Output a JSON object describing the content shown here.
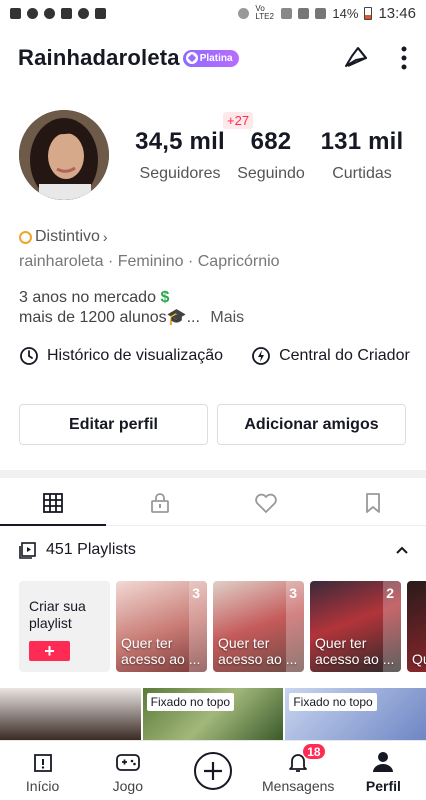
{
  "status_bar": {
    "battery": "14%",
    "time": "13:46",
    "network": "Vo LTE2"
  },
  "header": {
    "username": "Rainhadaroleta",
    "badge": "Platina"
  },
  "stats": {
    "followers": {
      "value": "34,5 mil",
      "label": "Seguidores"
    },
    "following": {
      "value": "682",
      "label": "Seguindo",
      "delta": "+27"
    },
    "likes": {
      "value": "131 mil",
      "label": "Curtidas"
    }
  },
  "profile": {
    "distintivo": "Distintivo",
    "meta": "rainharoleta · Feminino · Capricórnio",
    "bio_line1": "3 anos no mercado",
    "bio_line1_emoji": "$",
    "bio_line2": "mais de 1200 alunos🎓...",
    "bio_more": "Mais"
  },
  "shortcuts": [
    {
      "label": "Histórico de visualização",
      "icon": "clock-icon"
    },
    {
      "label": "Central do Criador",
      "icon": "lightning-icon"
    }
  ],
  "buttons": {
    "edit": "Editar perfil",
    "add_friends": "Adicionar amigos"
  },
  "tabs": [
    "videos-grid-icon",
    "lock-icon",
    "heart-icon",
    "bookmark-icon"
  ],
  "playlists": {
    "header": "451 Playlists",
    "create_label": "Criar sua playlist",
    "create_button": "+",
    "items": [
      {
        "count": "3",
        "title": "Quer ter acesso ao ..."
      },
      {
        "count": "3",
        "title": "Quer ter acesso ao ..."
      },
      {
        "count": "2",
        "title": "Quer ter acesso ao ..."
      },
      {
        "count": "",
        "title": "Qu"
      }
    ]
  },
  "grid": {
    "pinned_label": "Fixado no topo"
  },
  "bottom_nav": [
    {
      "label": "Início",
      "icon": "home-icon"
    },
    {
      "label": "Jogo",
      "icon": "gamepad-icon"
    },
    {
      "label": "",
      "icon": "create-plus-icon"
    },
    {
      "label": "Mensagens",
      "icon": "bell-icon",
      "badge": "18"
    },
    {
      "label": "Perfil",
      "icon": "person-icon"
    }
  ],
  "colors": {
    "accent": "#fe2c55",
    "platina": "#9a6cff",
    "text": "#161823"
  }
}
